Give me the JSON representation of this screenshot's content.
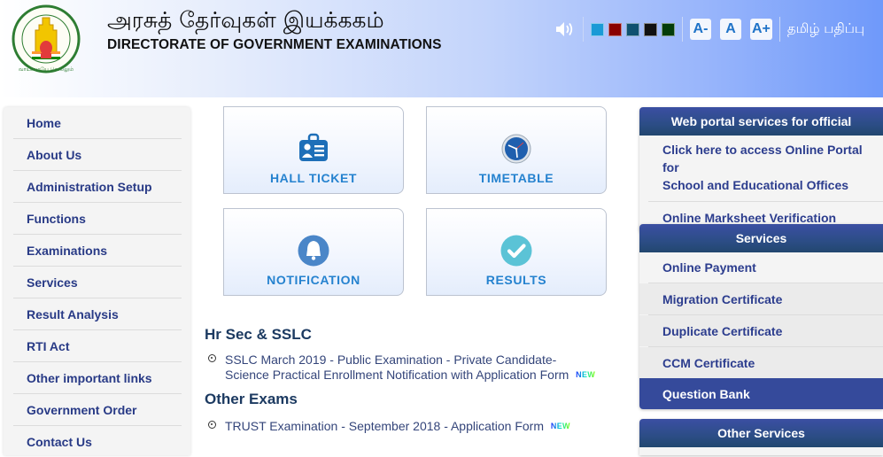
{
  "header": {
    "title_tamil": "அரசுத் தேர்வுகள் இயக்ககம்",
    "title_english": "DIRECTORATE OF GOVERNMENT EXAMINATIONS",
    "logo_icon": "tamilnadu-emblem-icon",
    "tools": {
      "speaker_icon": "speaker-icon",
      "theme_colors": [
        "#1a9ad6",
        "#8a0000",
        "#0f5170",
        "#111111",
        "#033d0a"
      ],
      "font_decrease": "A-",
      "font_normal": "A",
      "font_increase": "A+",
      "language_toggle": "தமிழ் பதிப்பு"
    }
  },
  "left_nav": {
    "items": [
      {
        "label": "Home"
      },
      {
        "label": "About Us"
      },
      {
        "label": "Administration Setup"
      },
      {
        "label": "Functions"
      },
      {
        "label": "Examinations"
      },
      {
        "label": "Services"
      },
      {
        "label": "Result Analysis"
      },
      {
        "label": "RTI Act"
      },
      {
        "label": "Other important links"
      },
      {
        "label": "Government Order"
      },
      {
        "label": "Contact Us"
      }
    ]
  },
  "tiles": [
    {
      "label": "HALL TICKET",
      "icon": "id-card-icon"
    },
    {
      "label": "TIMETABLE",
      "icon": "clock-icon"
    },
    {
      "label": "NOTIFICATION",
      "icon": "bell-icon"
    },
    {
      "label": "RESULTS",
      "icon": "checkmark-icon"
    }
  ],
  "news": {
    "sections": [
      {
        "heading": "Hr Sec & SSLC",
        "items": [
          {
            "line1": "SSLC March 2019 - Public Examination - Private Candidate-",
            "line2": "Science Practical Enrollment Notification with Application Form",
            "badge": "NEW"
          }
        ]
      },
      {
        "heading": "Other Exams",
        "items": [
          {
            "line1": "TRUST Examination - September 2018 - Application Form",
            "badge": "NEW"
          }
        ]
      }
    ]
  },
  "right_panels": {
    "web_portal": {
      "title": "Web portal services for official",
      "items": [
        {
          "line1": "Click here to access Online Portal for",
          "line2": "School and Educational Offices"
        },
        {
          "label": "Online Marksheet Verification"
        }
      ]
    },
    "services": {
      "title": "Services",
      "items": [
        {
          "label": "Online Payment"
        },
        {
          "label": "Migration Certificate"
        },
        {
          "label": "Duplicate Certificate"
        },
        {
          "label": "CCM Certificate"
        },
        {
          "label": "Question Bank"
        }
      ]
    },
    "other_services": {
      "title": "Other Services"
    }
  }
}
